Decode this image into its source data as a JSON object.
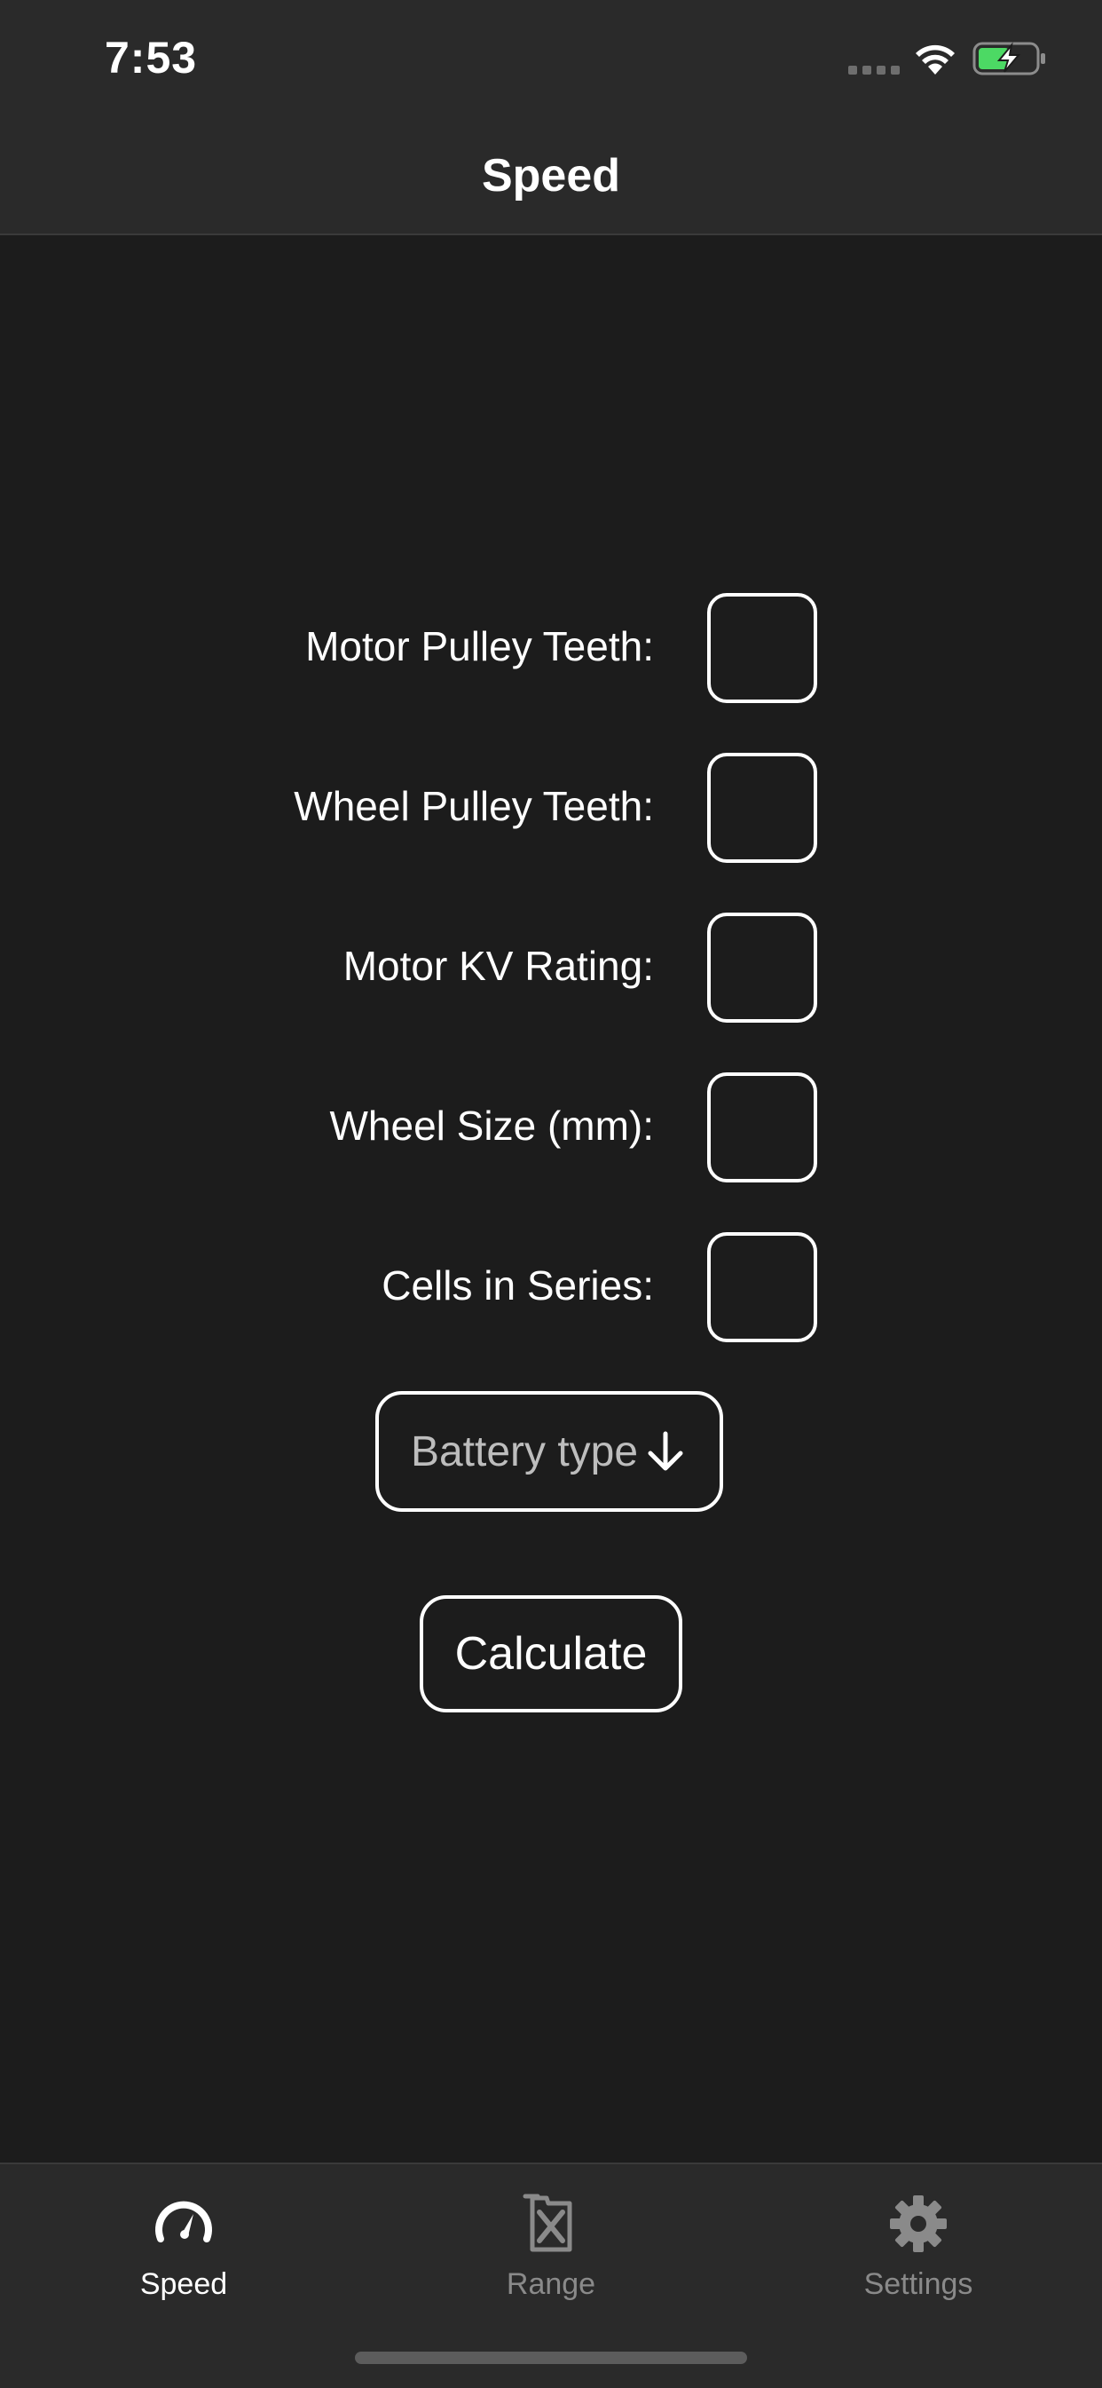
{
  "status_bar": {
    "time": "7:53",
    "battery_color": "#4cd964"
  },
  "nav": {
    "title": "Speed"
  },
  "form": {
    "fields": [
      {
        "label": "Motor Pulley Teeth:",
        "value": ""
      },
      {
        "label": "Wheel Pulley Teeth:",
        "value": ""
      },
      {
        "label": "Motor KV Rating:",
        "value": ""
      },
      {
        "label": "Wheel Size (mm):",
        "value": ""
      },
      {
        "label": "Cells in Series:",
        "value": ""
      }
    ],
    "battery_select": {
      "label": "Battery type",
      "icon": "arrow-down-icon"
    },
    "calculate_label": "Calculate"
  },
  "tabs": [
    {
      "label": "Speed",
      "icon": "speedometer-icon",
      "active": true
    },
    {
      "label": "Range",
      "icon": "fuel-can-icon",
      "active": false
    },
    {
      "label": "Settings",
      "icon": "gear-icon",
      "active": false
    }
  ],
  "colors": {
    "background": "#1c1c1c",
    "bar_background": "#2a2a2a",
    "active_tab": "#ffffff",
    "inactive_tab": "#8a8a8a"
  }
}
